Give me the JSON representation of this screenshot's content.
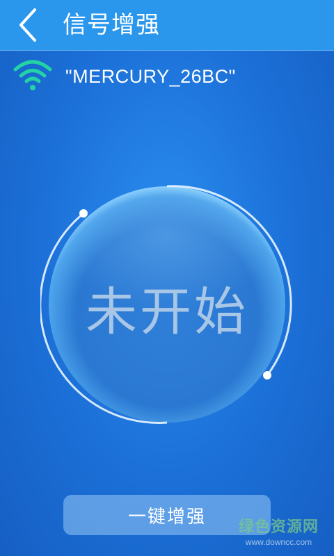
{
  "header": {
    "title": "信号增强",
    "back_icon": "chevron-left-icon"
  },
  "network": {
    "ssid": "\"MERCURY_26BC\"",
    "icon": "wifi-icon",
    "icon_color": "#23d3a5"
  },
  "booster": {
    "status": "未开始"
  },
  "action": {
    "label": "一键增强"
  },
  "watermark": {
    "text": "绿色资源网",
    "url": "www.downcc.com"
  },
  "colors": {
    "titlebar": "#2a96ec",
    "background": "#1b6fd6",
    "status_text": "#a8c6e6"
  }
}
